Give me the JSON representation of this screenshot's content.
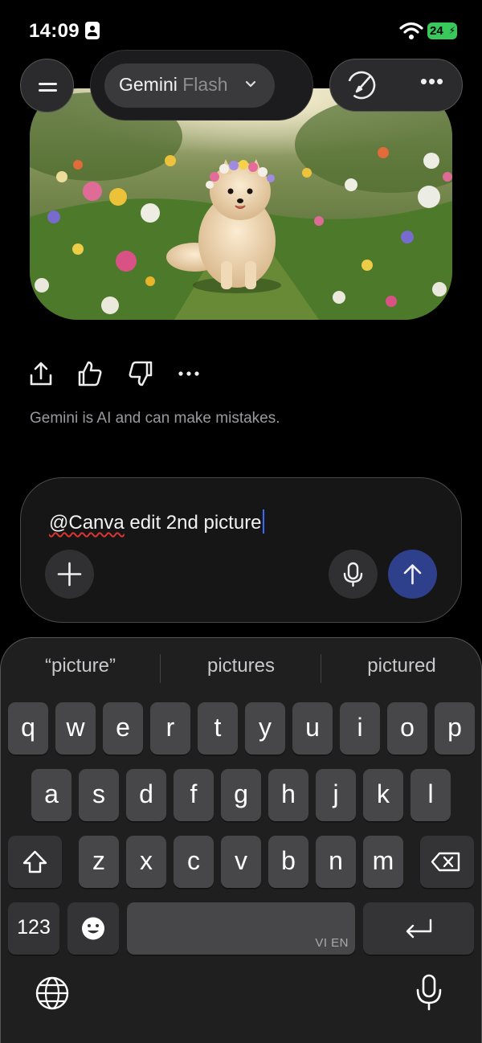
{
  "status_bar": {
    "time": "14:09",
    "battery_level": "24",
    "icons": [
      "contact-badge-icon",
      "wifi-icon",
      "battery-charging-icon"
    ]
  },
  "header": {
    "model_name": "Gemini",
    "model_variant": "Flash",
    "icons": [
      "menu-icon",
      "chevron-down-icon",
      "new-chat-icon",
      "more-icon"
    ]
  },
  "response": {
    "image_description_icon": "generated-dog-image",
    "actions": [
      "share-icon",
      "thumbs-up-icon",
      "thumbs-down-icon",
      "more-icon"
    ],
    "disclaimer": "Gemini is AI and can make mistakes."
  },
  "composer": {
    "mention": "@Canva",
    "text": " edit 2nd picture",
    "buttons": [
      "add-icon",
      "microphone-icon",
      "send-arrow-icon"
    ]
  },
  "keyboard": {
    "suggestions": [
      "“picture”",
      "pictures",
      "pictured"
    ],
    "row1": [
      "q",
      "w",
      "e",
      "r",
      "t",
      "y",
      "u",
      "i",
      "o",
      "p"
    ],
    "row2": [
      "a",
      "s",
      "d",
      "f",
      "g",
      "h",
      "j",
      "k",
      "l"
    ],
    "row3": [
      "z",
      "x",
      "c",
      "v",
      "b",
      "n",
      "m"
    ],
    "numbers_label": "123",
    "space_language": "VI EN",
    "colors": {
      "background": "#1f1f1f",
      "key": "#474749",
      "key_dark": "#343436",
      "send": "#2e3f8c"
    }
  }
}
